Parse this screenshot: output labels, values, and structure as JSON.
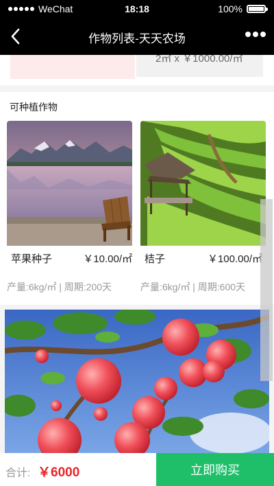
{
  "status_bar": {
    "carrier": "WeChat",
    "time": "18:18",
    "battery": "100%",
    "battery_level": 1.0
  },
  "nav": {
    "title": "作物列表-天天农场"
  },
  "prev_section": {
    "area_price_text": "2㎡ x ￥1000.00/㎡"
  },
  "crops_section": {
    "title": "可种植作物",
    "cards": [
      {
        "name": "苹果种子",
        "price": "￥10.00/㎡",
        "meta": "产量:6kg/㎡ | 周期:200天",
        "image": "lake-mountain-photo"
      },
      {
        "name": "桔子",
        "price": "￥100.00/㎡",
        "meta": "产量:6kg/㎡ | 周期:600天",
        "image": "rice-terrace-hut-photo"
      }
    ]
  },
  "banner": {
    "image": "apple-tree-photo"
  },
  "bottom_bar": {
    "total_label": "合计:",
    "total_amount": "￥6000",
    "buy_button": "立即购买"
  },
  "colors": {
    "accent_green": "#1fbf6a",
    "price_red": "#e8242b"
  }
}
